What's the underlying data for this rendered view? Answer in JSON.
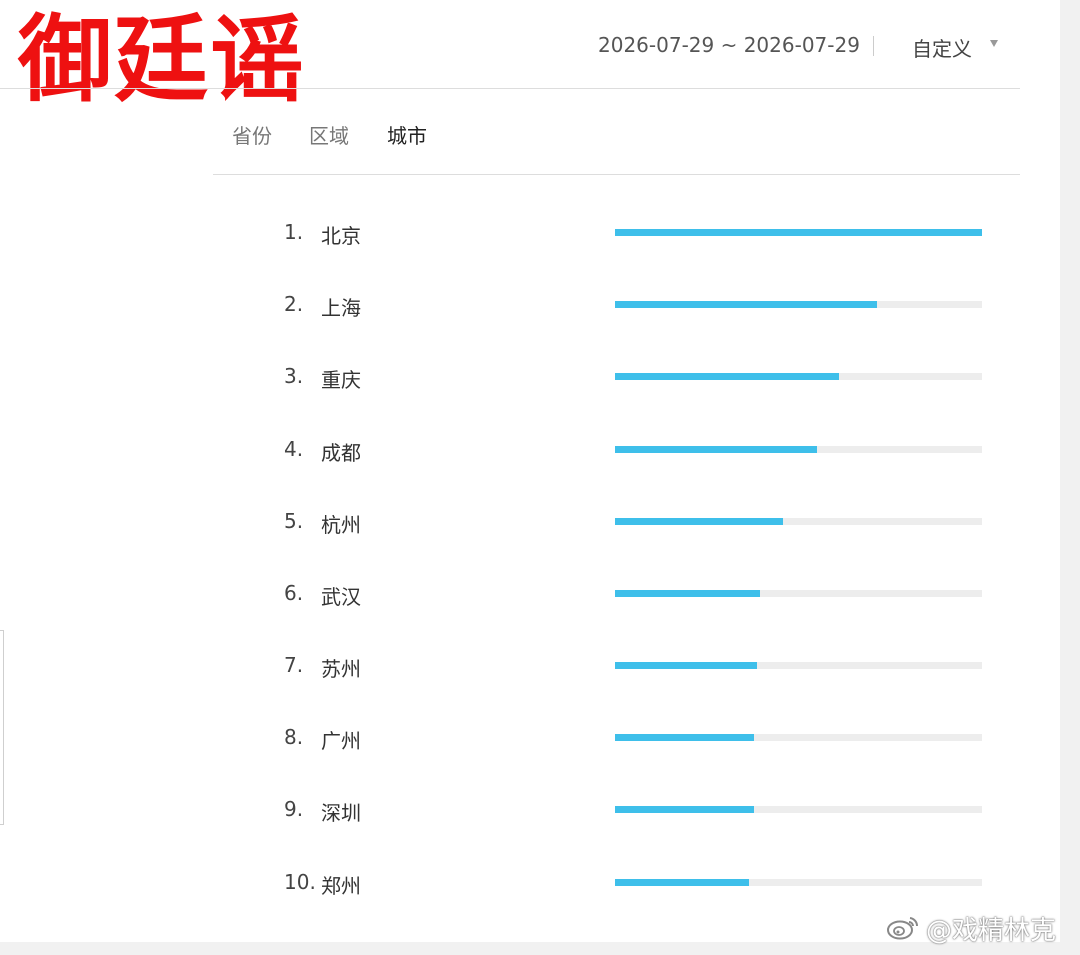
{
  "overlay": {
    "stamp_text": "御廷谣"
  },
  "header": {
    "date_range": "2026-07-29 ~ 2026-07-29",
    "custom_label": "自定义"
  },
  "tabs": [
    {
      "label": "省份",
      "active": false
    },
    {
      "label": "区域",
      "active": false
    },
    {
      "label": "城市",
      "active": true
    }
  ],
  "ranking": {
    "rows": [
      {
        "rank": "1.",
        "city": "北京",
        "level": 1.0
      },
      {
        "rank": "2.",
        "city": "上海",
        "level": 0.713
      },
      {
        "rank": "3.",
        "city": "重庆",
        "level": 0.61
      },
      {
        "rank": "4.",
        "city": "成都",
        "level": 0.55
      },
      {
        "rank": "5.",
        "city": "杭州",
        "level": 0.458
      },
      {
        "rank": "6.",
        "city": "武汉",
        "level": 0.395
      },
      {
        "rank": "7.",
        "city": "苏州",
        "level": 0.387
      },
      {
        "rank": "8.",
        "city": "广州",
        "level": 0.379
      },
      {
        "rank": "9.",
        "city": "深圳",
        "level": 0.379
      },
      {
        "rank": "10.",
        "city": "郑州",
        "level": 0.366
      }
    ]
  },
  "watermark": {
    "text": "@戏精林克"
  },
  "colors": {
    "bar_fill": "#3ebfea",
    "bar_track": "#ededed",
    "stamp": "#ee1111"
  }
}
